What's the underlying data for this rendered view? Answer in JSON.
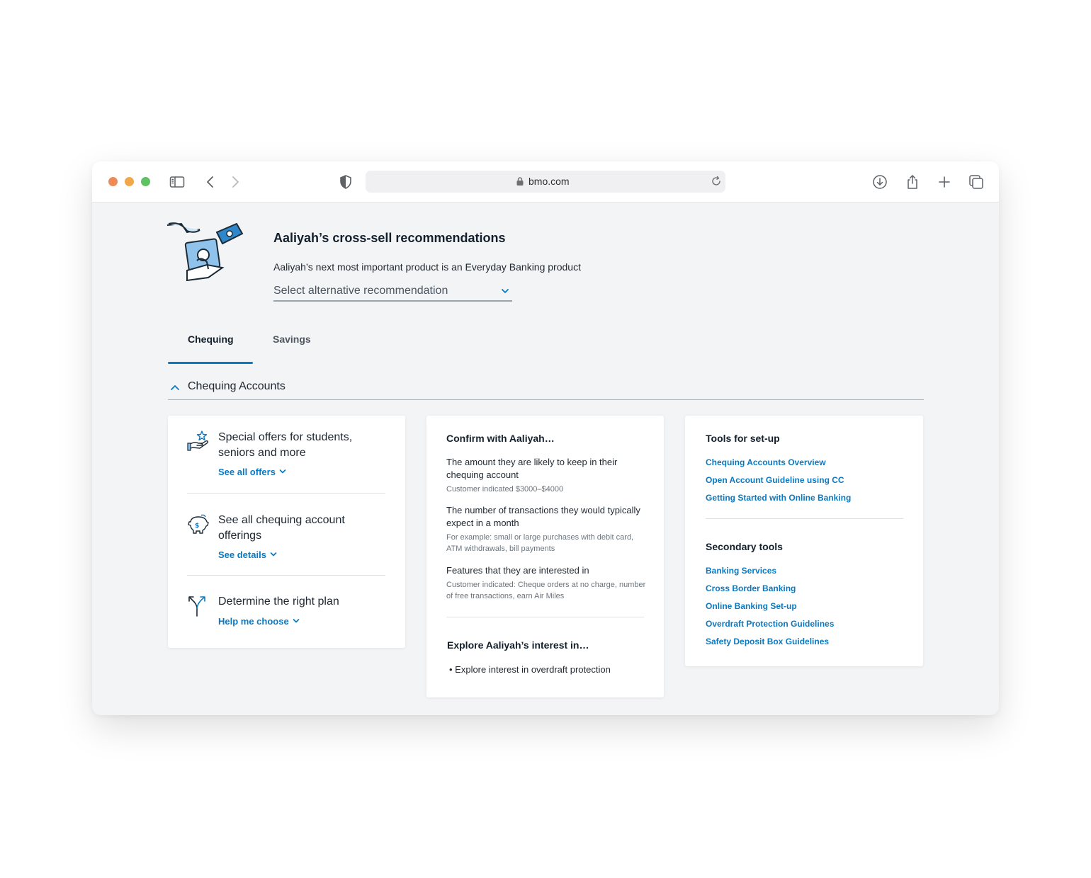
{
  "browser": {
    "url": "bmo.com"
  },
  "header": {
    "title": "Aaliyah’s cross-sell recommendations",
    "subtitle": "Aaliyah’s next most important product is an Everyday Banking product",
    "select_value": "Select alternative recommendation"
  },
  "tabs": [
    {
      "label": "Chequing"
    },
    {
      "label": "Savings"
    }
  ],
  "section": {
    "label": "Chequing Accounts"
  },
  "offers": [
    {
      "text": "Special offers for students, seniors and more",
      "link": "See all offers",
      "icon": "hand-star-icon"
    },
    {
      "text": "See all chequing account offerings",
      "link": "See details",
      "icon": "piggy-bank-icon"
    },
    {
      "text": "Determine the right plan",
      "link": "Help me choose",
      "icon": "split-arrows-icon"
    }
  ],
  "confirm": {
    "title": "Confirm with Aaliyah…",
    "items": [
      {
        "main": "The amount they are likely to keep in their chequing account",
        "note": "Customer indicated $3000–$4000"
      },
      {
        "main": "The number of transactions they would typically expect in a month",
        "note": "For example: small or large purchases with debit card, ATM withdrawals, bill payments"
      },
      {
        "main": "Features that they are interested in",
        "note": "Customer indicated: Cheque orders at no charge, number of free transactions, earn Air Miles"
      }
    ],
    "explore_title": "Explore Aaliyah’s interest in…",
    "explore_bullet": "• Explore interest in overdraft protection"
  },
  "tools": {
    "title": "Tools for set-up",
    "links": [
      "Chequing Accounts Overview",
      "Open Account Guideline using CC",
      "Getting Started with Online Banking"
    ],
    "secondary_title": "Secondary tools",
    "secondary_links": [
      "Banking Services",
      "Cross Border Banking",
      "Online Banking Set-up",
      "Overdraft Protection Guidelines",
      "Safety Deposit Box Guidelines"
    ]
  },
  "colors": {
    "accent": "#0a79c2",
    "background": "#f3f4f6"
  }
}
